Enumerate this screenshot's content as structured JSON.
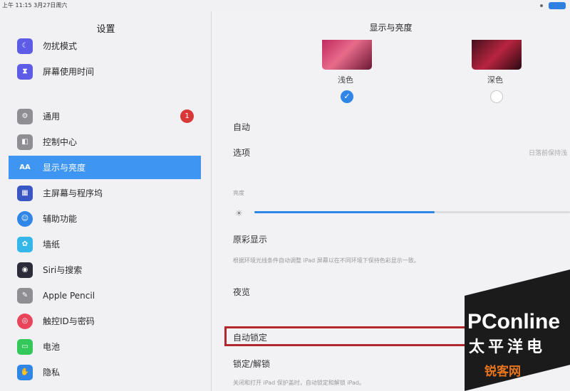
{
  "status": {
    "time": "上午 11:15  3月27日周六"
  },
  "sidebar": {
    "title": "设置",
    "items": [
      {
        "label": "勿扰模式",
        "icon": "moon-icon",
        "color": "#5e5ce6"
      },
      {
        "label": "屏幕使用时间",
        "icon": "hourglass-icon",
        "color": "#5e5ce6"
      },
      {
        "label": "通用",
        "icon": "gear-icon",
        "color": "#8e8e93",
        "badge": "1"
      },
      {
        "label": "控制中心",
        "icon": "toggles-icon",
        "color": "#8e8e93"
      },
      {
        "label": "显示与亮度",
        "icon": "text-size-icon",
        "color": "#3e95f2",
        "active": true
      },
      {
        "label": "主屏幕与程序坞",
        "icon": "grid-icon",
        "color": "#3a55c4"
      },
      {
        "label": "辅助功能",
        "icon": "accessibility-icon",
        "color": "#2f86e6"
      },
      {
        "label": "墙纸",
        "icon": "flower-icon",
        "color": "#35b6e8"
      },
      {
        "label": "Siri与搜索",
        "icon": "siri-icon",
        "color": "#2b2b3a"
      },
      {
        "label": "Apple Pencil",
        "icon": "pencil-icon",
        "color": "#8e8e93"
      },
      {
        "label": "触控ID与密码",
        "icon": "fingerprint-icon",
        "color": "#e8445a"
      },
      {
        "label": "电池",
        "icon": "battery-icon",
        "color": "#34c759"
      },
      {
        "label": "隐私",
        "icon": "hand-icon",
        "color": "#2f86e6"
      }
    ]
  },
  "detail": {
    "title": "显示与亮度",
    "appearance": {
      "light_label": "浅色",
      "dark_label": "深色",
      "selected": "light"
    },
    "auto_label": "自动",
    "options_label": "选项",
    "options_value": "日落前保持浅",
    "brightness_label": "亮度",
    "brightness_level": 0.57,
    "true_tone_label": "原彩显示",
    "true_tone_desc": "根据环境光线条件自动调整 iPad 屏幕以在不同环境下保持色彩显示一致。",
    "night_shift_label": "夜览",
    "auto_lock_label": "自动锁定",
    "lock_unlock_label": "锁定/解锁",
    "lock_unlock_desc": "关闭和打开 iPad 保护盖时，自动锁定和解锁 iPad。"
  },
  "watermark": {
    "brand": "PConline",
    "cn": "太平洋电",
    "site": "锐客网"
  }
}
